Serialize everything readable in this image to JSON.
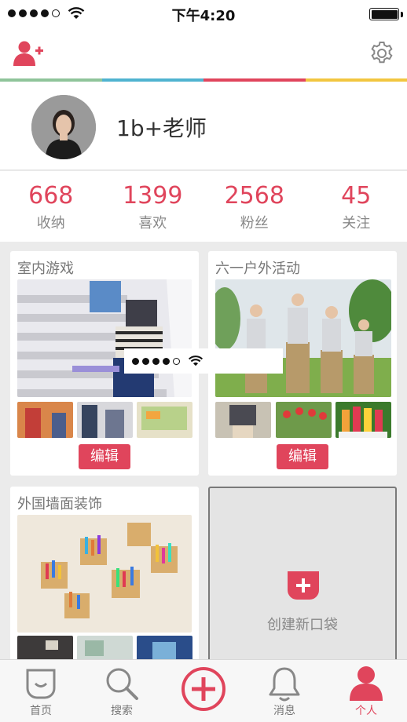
{
  "status_bar": {
    "time": "下午4:20"
  },
  "colors": {
    "accent": "#e0455c",
    "strip": [
      "#8fc49a",
      "#4fb3d0",
      "#e0455c",
      "#f2c640"
    ]
  },
  "profile": {
    "username": "1b+老师"
  },
  "stats": [
    {
      "value": "668",
      "label": "收纳"
    },
    {
      "value": "1399",
      "label": "喜欢"
    },
    {
      "value": "2568",
      "label": "粉丝"
    },
    {
      "value": "45",
      "label": "关注"
    }
  ],
  "boards": [
    {
      "title": "室内游戏",
      "edit_label": "编辑"
    },
    {
      "title": "六一户外活动",
      "edit_label": "编辑"
    },
    {
      "title": "外国墙面装饰"
    }
  ],
  "new_bag": {
    "label": "创建新口袋"
  },
  "tabs": [
    {
      "label": "首页",
      "icon": "home-icon"
    },
    {
      "label": "搜索",
      "icon": "search-icon"
    },
    {
      "label": "",
      "icon": "add-circle-icon"
    },
    {
      "label": "消息",
      "icon": "bell-icon"
    },
    {
      "label": "个人",
      "icon": "person-icon"
    }
  ]
}
